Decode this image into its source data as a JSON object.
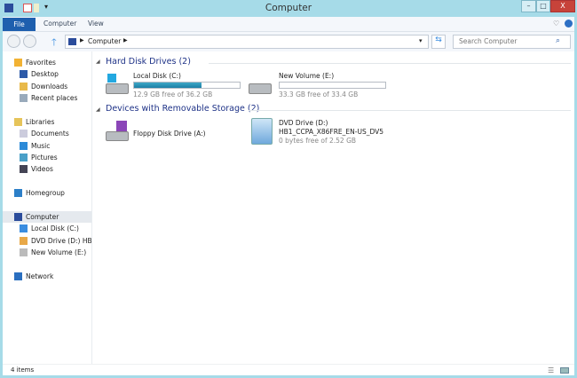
{
  "window": {
    "title": "Computer",
    "minimize": "–",
    "maximize": "□",
    "close": "X"
  },
  "ribbon": {
    "tabs": [
      {
        "label": "File"
      },
      {
        "label": "Computer"
      },
      {
        "label": "View"
      }
    ]
  },
  "address": {
    "path": [
      "Computer"
    ],
    "search_placeholder": "Search Computer"
  },
  "nav": {
    "items": [
      {
        "label": "Favorites",
        "icon": "star-icon",
        "level": 0
      },
      {
        "label": "Desktop",
        "icon": "desktop-icon",
        "level": 1
      },
      {
        "label": "Downloads",
        "icon": "downloads-icon",
        "level": 1
      },
      {
        "label": "Recent places",
        "icon": "recent-places-icon",
        "level": 1
      },
      {
        "label": "Libraries",
        "icon": "libraries-icon",
        "level": 0
      },
      {
        "label": "Documents",
        "icon": "documents-icon",
        "level": 1
      },
      {
        "label": "Music",
        "icon": "music-icon",
        "level": 1
      },
      {
        "label": "Pictures",
        "icon": "pictures-icon",
        "level": 1
      },
      {
        "label": "Videos",
        "icon": "videos-icon",
        "level": 1
      },
      {
        "label": "Homegroup",
        "icon": "homegroup-icon",
        "level": 0
      },
      {
        "label": "Computer",
        "icon": "computer-icon",
        "level": 0
      },
      {
        "label": "Local Disk (C:)",
        "icon": "local-disk-icon",
        "level": 1
      },
      {
        "label": "DVD Drive (D:) HB1_",
        "icon": "dvd-drive-icon",
        "level": 1
      },
      {
        "label": "New Volume (E:)",
        "icon": "drive-icon",
        "level": 1
      },
      {
        "label": "Network",
        "icon": "network-icon",
        "level": 0
      }
    ]
  },
  "content": {
    "groups": [
      {
        "title": "Hard Disk Drives (2)",
        "items": [
          {
            "name": "Local Disk (C:)",
            "detail": "12.9 GB free of 36.2 GB",
            "used_fraction": 0.64
          },
          {
            "name": "New Volume (E:)",
            "detail": "33.3 GB free of 33.4 GB",
            "used_fraction": 0.003
          }
        ]
      },
      {
        "title": "Devices with Removable Storage (2)",
        "items": [
          {
            "name": "Floppy Disk Drive (A:)"
          },
          {
            "name": "DVD Drive (D:)",
            "label": "HB1_CCPA_X86FRE_EN-US_DV5",
            "detail": "0 bytes free of 2.52 GB"
          }
        ]
      }
    ]
  },
  "status": {
    "count": "4 items"
  },
  "colors": {
    "accent": "#1e5fae",
    "group_title": "#1e3287",
    "frame": "#a6dbe8",
    "bar_fill": "#2a93b8"
  }
}
